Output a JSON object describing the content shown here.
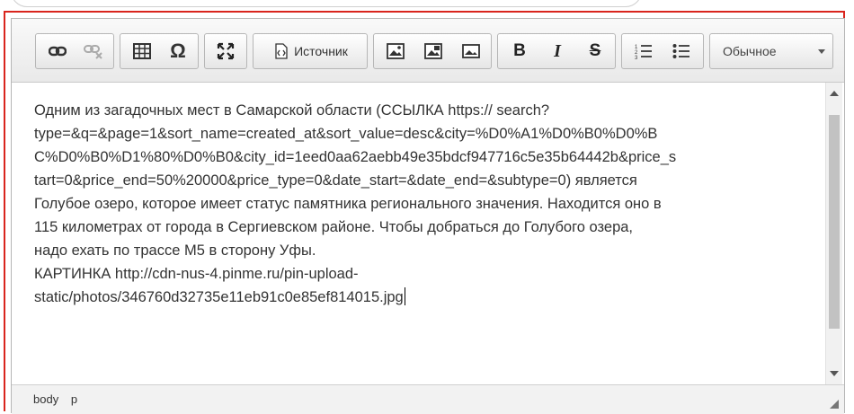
{
  "toolbar": {
    "source_label": "Источник",
    "format_value": "Обычное",
    "icons": [
      "link-icon",
      "unlink-icon",
      "table-icon",
      "special-char-icon",
      "maximize-icon",
      "source-icon",
      "image-icon",
      "image2-icon",
      "image3-icon",
      "bold-icon",
      "italic-icon",
      "strike-icon",
      "numbered-list-icon",
      "bulleted-list-icon"
    ]
  },
  "toolbar_glyphs": {
    "omega": "Ω",
    "bold": "B",
    "italic": "I",
    "strike": "S"
  },
  "content": {
    "paragraph_lines": [
      "Одним из загадочных мест в Самарской области (ССЫЛКА https://                   search?",
      "type=&q=&page=1&sort_name=created_at&sort_value=desc&city=%D0%A1%D0%B0%D0%B",
      "C%D0%B0%D1%80%D0%B0&city_id=1eed0aa62aebb49e35bdcf947716c5e35b64442b&price_s",
      "tart=0&price_end=50%20000&price_type=0&date_start=&date_end=&subtype=0) является",
      "Голубое озеро, которое имеет статус памятника регионального значения. Находится оно в",
      "115 километрах от города в Сергиевском районе. Чтобы добраться до Голубого озера,",
      "надо ехать по трассе М5 в сторону Уфы.",
      "КАРТИНКА http://cdn-nus-4.pinme.ru/pin-upload-",
      "static/photos/346760d32735e11eb91c0e85ef814015.jpg"
    ]
  },
  "statusbar": {
    "path": [
      "body",
      "p"
    ]
  },
  "colors": {
    "frame_border": "#d9251d",
    "toolbar_bg": "#eeeeee"
  }
}
